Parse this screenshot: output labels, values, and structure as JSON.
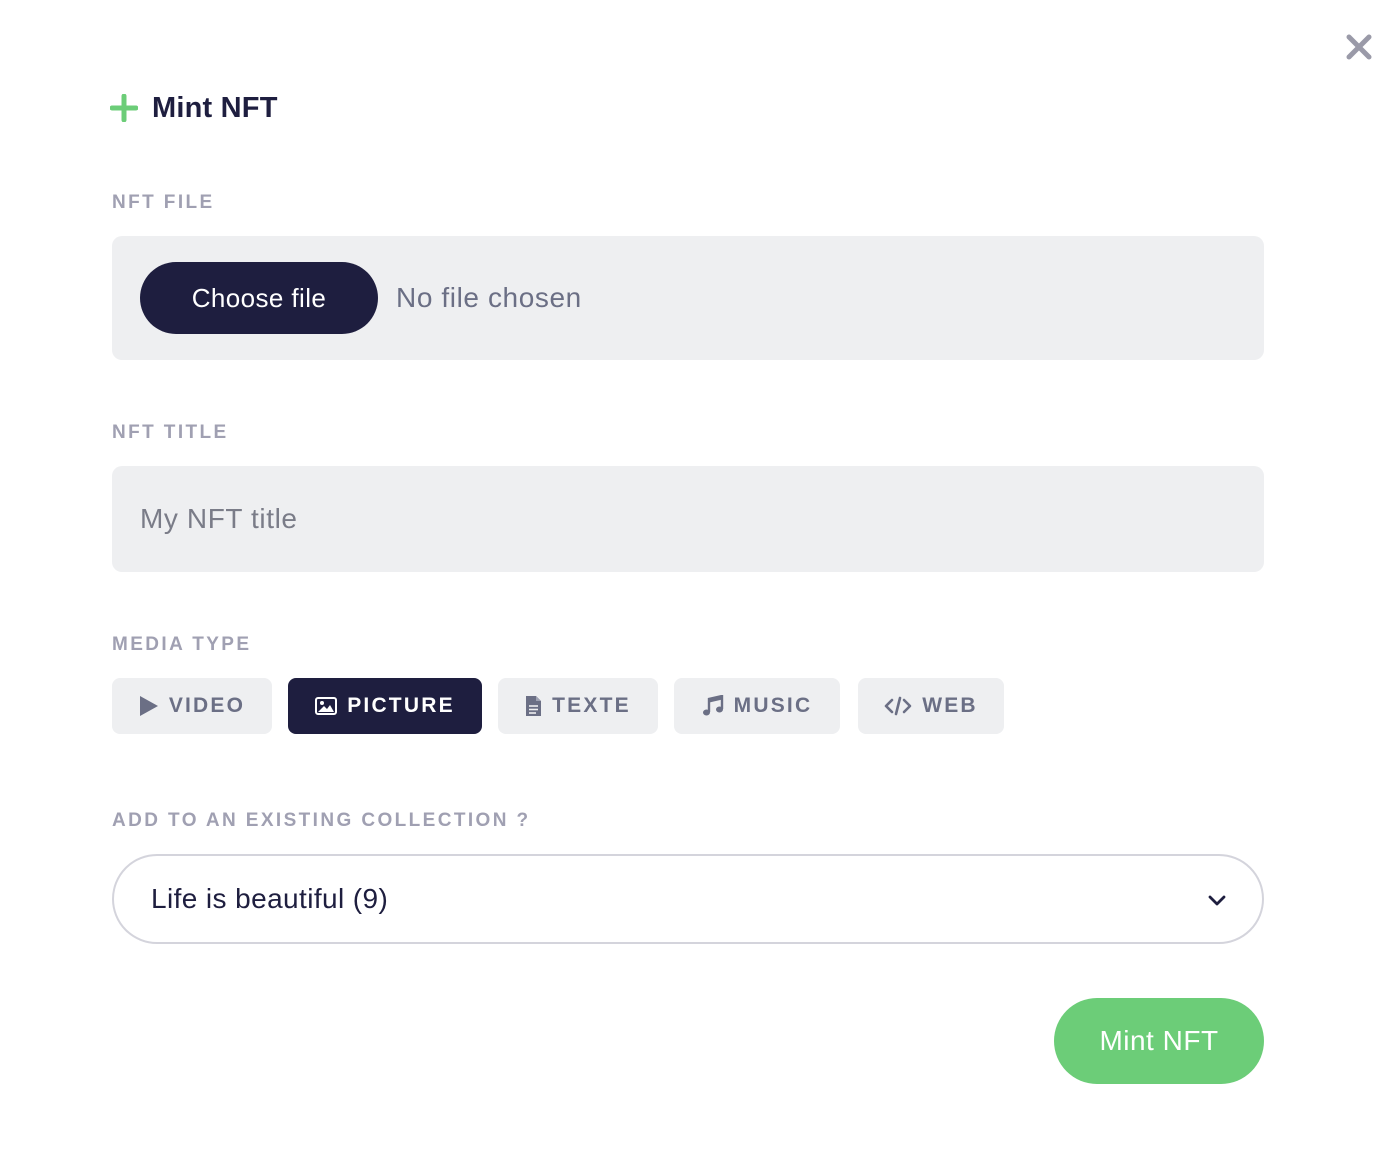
{
  "modal": {
    "title": "Mint NFT",
    "close_icon": "close-icon",
    "accent_color": "#6ccd78",
    "dark_color": "#1e1e3f"
  },
  "file_field": {
    "label": "NFT FILE",
    "button_label": "Choose file",
    "status": "No file chosen"
  },
  "title_field": {
    "label": "NFT TITLE",
    "placeholder": "My NFT title",
    "value": ""
  },
  "media_type": {
    "label": "MEDIA TYPE",
    "selected": "PICTURE",
    "options": [
      {
        "label": "VIDEO",
        "icon": "play-icon"
      },
      {
        "label": "PICTURE",
        "icon": "image-icon"
      },
      {
        "label": "TEXTE",
        "icon": "document-icon"
      },
      {
        "label": "MUSIC",
        "icon": "music-note-icon"
      },
      {
        "label": "WEB",
        "icon": "code-icon"
      }
    ]
  },
  "collection": {
    "label": "ADD TO AN EXISTING COLLECTION ?",
    "selected_value": "Life is beautiful (9)"
  },
  "submit": {
    "label": "Mint NFT"
  }
}
